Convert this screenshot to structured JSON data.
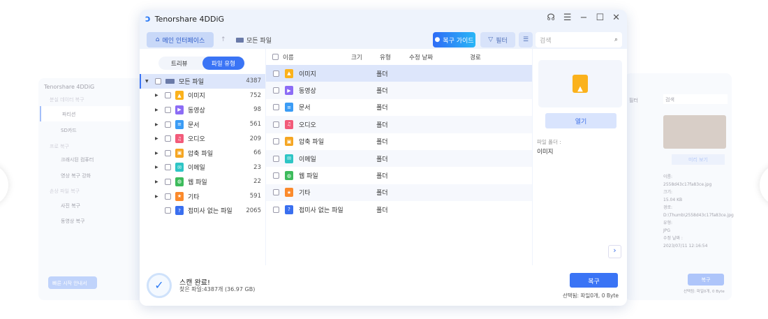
{
  "app": {
    "title": "Tenorshare 4DDiG"
  },
  "toolbar": {
    "home": "메인 인터페이스",
    "breadcrumb": "모든 파일",
    "guide": "복구 가이드",
    "filter": "필터",
    "search_placeholder": "검색"
  },
  "tabs": {
    "tree": "트리뷰",
    "filetype": "파일 유형"
  },
  "tree": {
    "root": {
      "label": "모든 파일",
      "count": "4387"
    },
    "items": [
      {
        "label": "이미지",
        "count": "752",
        "icon": "image-icon",
        "color": "#fbb21c",
        "glyph": "▲"
      },
      {
        "label": "동영상",
        "count": "98",
        "icon": "video-icon",
        "color": "#8c6cf5",
        "glyph": "▶"
      },
      {
        "label": "문서",
        "count": "561",
        "icon": "document-icon",
        "color": "#3b9cf5",
        "glyph": "≡"
      },
      {
        "label": "오디오",
        "count": "209",
        "icon": "audio-icon",
        "color": "#f25b7a",
        "glyph": "♫"
      },
      {
        "label": "압축 파일",
        "count": "66",
        "icon": "archive-icon",
        "color": "#f5a623",
        "glyph": "▣"
      },
      {
        "label": "이메일",
        "count": "23",
        "icon": "email-icon",
        "color": "#2ec5c5",
        "glyph": "✉"
      },
      {
        "label": "웹 파일",
        "count": "22",
        "icon": "web-icon",
        "color": "#3dbb5c",
        "glyph": "◍"
      },
      {
        "label": "기타",
        "count": "591",
        "icon": "other-icon",
        "color": "#fb8a2c",
        "glyph": "★"
      },
      {
        "label": "접미사 없는 파일",
        "count": "2065",
        "icon": "unknown-icon",
        "color": "#3a6fef",
        "glyph": "?"
      }
    ]
  },
  "list": {
    "headers": {
      "name": "이름",
      "size": "크기",
      "type": "유형",
      "modified": "수정 날짜",
      "path": "경로"
    },
    "folder_type": "폴더"
  },
  "preview": {
    "open": "열기",
    "label": "파일 폴더 :",
    "value": "이미지"
  },
  "footer": {
    "title": "스캔 완료!",
    "summary": "찾은 파일:4387개 (36.97 GB)",
    "recover": "복구",
    "selected": "선택됨: 파일0개, 0 Byte"
  },
  "bg_left": {
    "brand": "Tenorshare 4DDiG",
    "section1": "분실 데이터 복구",
    "partition": "파티션",
    "sd": "SD카드",
    "section2": "프로 복구",
    "crashed": "크래시된 컴퓨터",
    "video_enh": "영상 복구 강화",
    "section3": "손상 파일 복구",
    "photo": "사진 복구",
    "video": "동영상 복구",
    "quickstart": "빠른 시작 안내서"
  },
  "bg_right": {
    "filter": "필터",
    "search": "검색",
    "preview": "미리 보기",
    "name_l": "이름:",
    "name": "2558d43c17fa83ce.jpg",
    "size_l": "크기:",
    "size": "15.04 KB",
    "path_l": "경로:",
    "path": "D:\\Thumb\\2558d43c17fa83ce.jpg",
    "type_l": "유형:",
    "type": "JPG",
    "date_l": "수정 날짜 :",
    "date": "2023/07/11 12:16:54",
    "recover": "복구",
    "selected": "선택됨: 파일0개, 0 Byte"
  }
}
